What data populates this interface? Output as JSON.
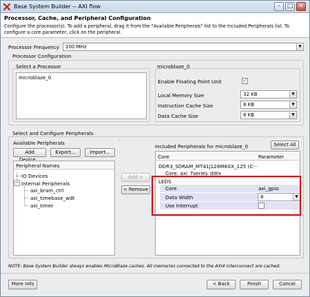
{
  "window": {
    "title": "Base System Builder -- AXI flow",
    "minimize": "–",
    "maximize": "□",
    "close": "✕"
  },
  "header": {
    "heading": "Processor, Cache, and Peripheral Configuration",
    "description": "Configure the processor(s). To add a peripheral, drag it from the \"Available Peripherals\" list to the Included Peripherals list. To configure a core parameter, click on the peripheral."
  },
  "processor_frequency": {
    "label": "Processor Frequency",
    "value": "100 MHz"
  },
  "processor_config": {
    "group_label": "Processor Configuration",
    "select_label": "Select a Processor",
    "processors": [
      "microblaze_0"
    ],
    "selected_name": "microblaze_0",
    "fpu_label": "Enable Floating Point Unit",
    "fpu_checked": true,
    "local_memory_label": "Local Memory Size",
    "local_memory_value": "32 KB",
    "icache_label": "Instruction Cache Size",
    "icache_value": "8 KB",
    "dcache_label": "Data Cache Size",
    "dcache_value": "8 KB"
  },
  "peripherals": {
    "group_label": "Select and Configure Peripherals",
    "available_label": "Available Peripherals",
    "add_device": "Add Device...",
    "export": "Export...",
    "import": "Import...",
    "tree_header": "Peripheral Names",
    "tree": {
      "io_devices": "IO Devices",
      "internal": "Internal Peripherals",
      "children": [
        "axi_bram_ctrl",
        "axi_timebase_wdt",
        "axi_timer"
      ]
    },
    "add_button": "Add >",
    "remove_button": "< Remove",
    "included_label": "Included Peripherals for microblaze_0",
    "select_all": "Select All",
    "table_headers": [
      "Core",
      "Parameter"
    ],
    "ddr_name": "DDR3_SDRAM_MT41J128M8XX_125 (C···",
    "ddr_core": "Core: axi_7series_ddrx",
    "leds_name": "LEDS",
    "leds_rows": [
      {
        "name": "Core",
        "value": "axi_gpio"
      },
      {
        "name": "Data Width",
        "value": "8"
      },
      {
        "name": "Use Interrupt",
        "value": ""
      }
    ],
    "interrupt_checked": false
  },
  "note": "NOTE: Base System Builder always enables MicroBlaze caches. All memories connected to the AXI4 interconnect are cached.",
  "footer": {
    "more_info": "More Info",
    "back": "< Back",
    "finish": "Finish",
    "cancel": "Cancel"
  },
  "highlight_color": "#d9000d",
  "selection_color": "#dfe3f5"
}
